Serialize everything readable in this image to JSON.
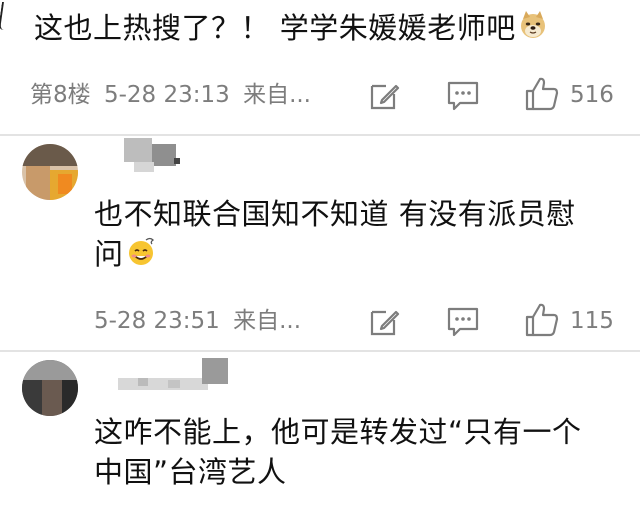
{
  "thread": {
    "top_comment": {
      "text": "这也上热搜了？！ 学学朱媛媛老师吧",
      "floor": "第8楼",
      "time": "5-28 23:13",
      "source": "来自...",
      "likes": "516",
      "emoji_icon": "doge-emoji-icon"
    },
    "replies": [
      {
        "text_line1": "也不知联合国知不知道 有没有派员慰",
        "text_line2": "问",
        "time": "5-28 23:51",
        "source": "来自...",
        "likes": "115",
        "emoji_icon": "dizzy-smile-emoji-icon"
      },
      {
        "text_line1": "这咋不能上，他可是转发过“只有一个",
        "text_line2": "中国”台湾艺人"
      }
    ]
  },
  "icons": {
    "edit": "edit-icon",
    "comment": "comment-icon",
    "like": "thumbs-up-icon"
  },
  "colors": {
    "text": "#111111",
    "meta": "#7d7d7d",
    "divider": "#e3e3e3"
  }
}
